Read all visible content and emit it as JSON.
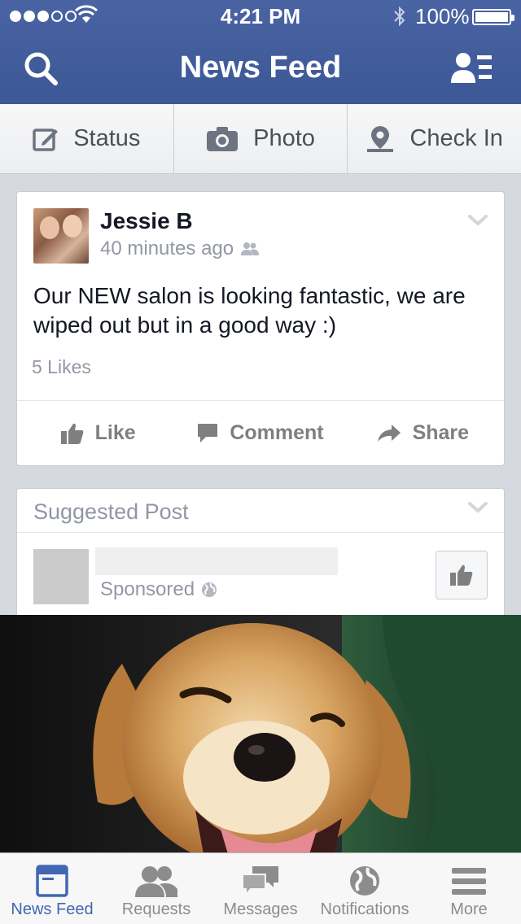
{
  "status_bar": {
    "time": "4:21 PM",
    "battery": "100%",
    "signal_bars": 3,
    "signal_total": 5
  },
  "header": {
    "title": "News Feed"
  },
  "publisher": {
    "status_label": "Status",
    "photo_label": "Photo",
    "checkin_label": "Check In"
  },
  "post": {
    "author": "Jessie B",
    "time": "40 minutes ago",
    "text": "Our NEW salon is looking fantastic, we are wiped out but in a good way :)",
    "likes": "5 Likes",
    "actions": {
      "like": "Like",
      "comment": "Comment",
      "share": "Share"
    }
  },
  "suggested": {
    "heading": "Suggested Post",
    "meta": "Sponsored"
  },
  "tabs": [
    {
      "label": "News Feed",
      "active": true
    },
    {
      "label": "Requests",
      "active": false
    },
    {
      "label": "Messages",
      "active": false
    },
    {
      "label": "Notifications",
      "active": false
    },
    {
      "label": "More",
      "active": false
    }
  ],
  "colors": {
    "brand": "#3b5998",
    "active_tab": "#4267b2",
    "muted": "#9197a3"
  }
}
